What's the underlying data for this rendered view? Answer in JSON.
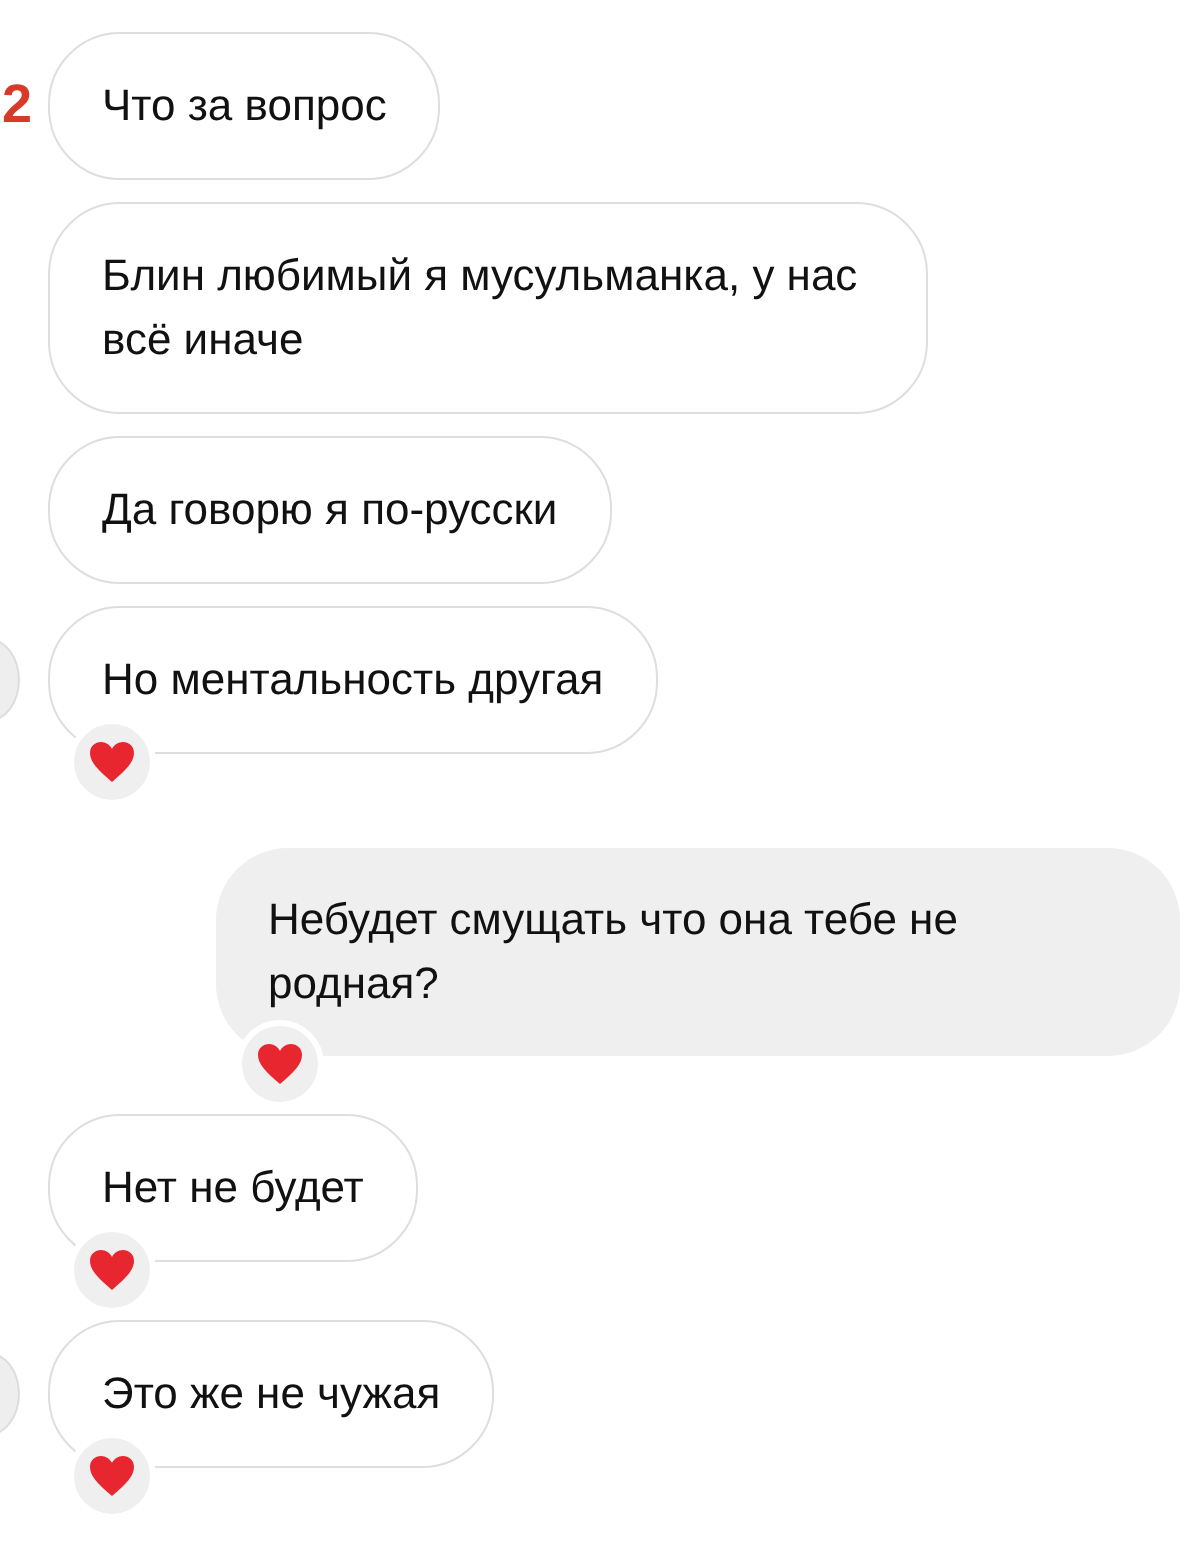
{
  "edge_mark": "2",
  "messages": [
    {
      "kind": "incoming",
      "text": "Что за вопрос",
      "reaction": false,
      "avatar": false
    },
    {
      "kind": "incoming",
      "text": "Блин любимый я мусульманка, у нас всё иначе",
      "reaction": false,
      "avatar": false
    },
    {
      "kind": "incoming",
      "text": "Да говорю я по-русски",
      "reaction": false,
      "avatar": false
    },
    {
      "kind": "incoming",
      "text": "Но ментальность другая",
      "reaction": true,
      "avatar": true
    },
    {
      "kind": "outgoing",
      "text": "Небудет смущать что она тебе не родная?",
      "reaction": true,
      "avatar": false
    },
    {
      "kind": "incoming",
      "text": "Нет не будет",
      "reaction": true,
      "avatar": false
    },
    {
      "kind": "incoming",
      "text": "Это же не чужая",
      "reaction": true,
      "avatar": true
    }
  ]
}
